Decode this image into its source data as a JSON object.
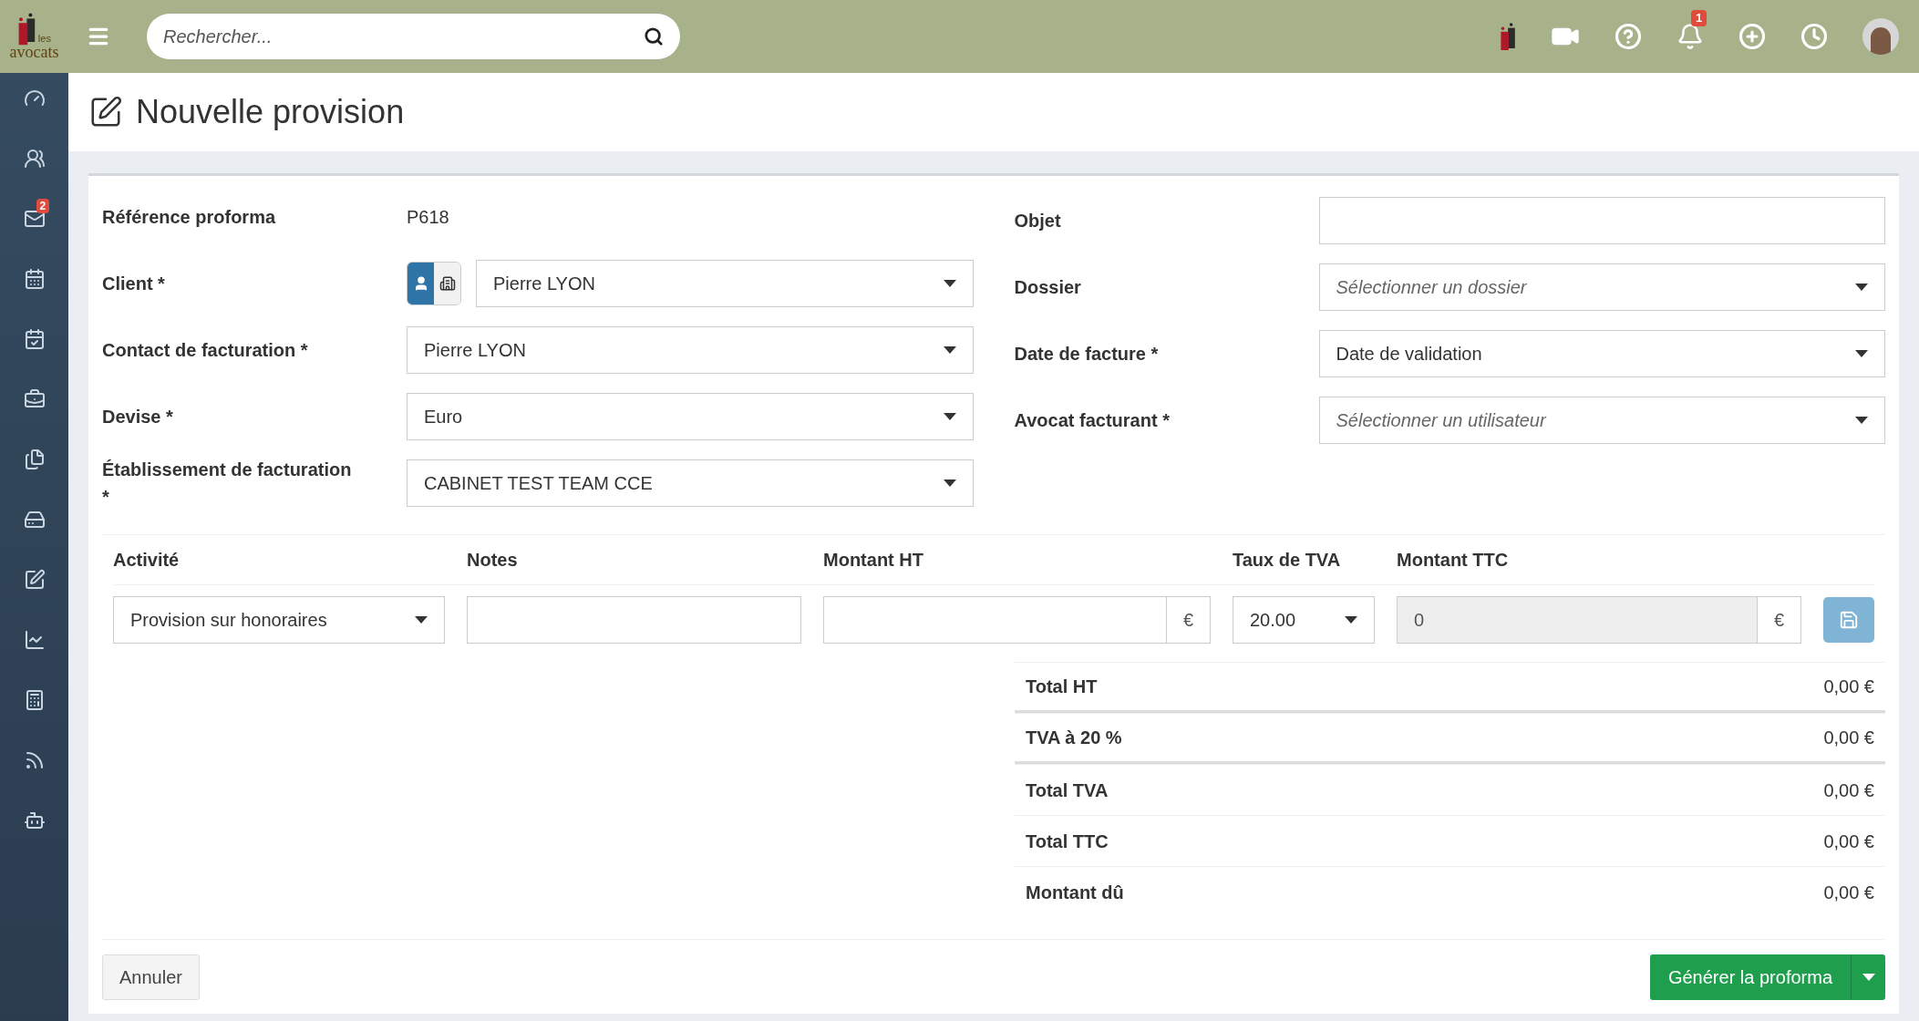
{
  "brand": {
    "small": "les",
    "name": "avocats"
  },
  "search": {
    "placeholder": "Rechercher..."
  },
  "notifications": {
    "badge": "1"
  },
  "sidebar": {
    "mail_badge": "2"
  },
  "page_title": "Nouvelle provision",
  "left_fields": [
    {
      "label": "Référence proforma",
      "kind": "static",
      "value": "P618"
    },
    {
      "label": "Client *",
      "kind": "client",
      "value": "Pierre LYON",
      "toggle": [
        {
          "selected": true
        },
        {
          "selected": false
        }
      ]
    },
    {
      "label": "Contact de facturation *",
      "kind": "select",
      "value": "Pierre LYON"
    },
    {
      "label": "Devise *",
      "kind": "select",
      "value": "Euro"
    },
    {
      "label": "Établissement de facturation *",
      "kind": "select",
      "value": "CABINET TEST TEAM CCE"
    }
  ],
  "right_fields": [
    {
      "label": "Objet",
      "kind": "input"
    },
    {
      "label": "Dossier",
      "kind": "select",
      "placeholder": "Sélectionner un dossier"
    },
    {
      "label": "Date de facture *",
      "kind": "select",
      "value": "Date de validation"
    },
    {
      "label": "Avocat facturant *",
      "kind": "select",
      "placeholder": "Sélectionner un utilisateur"
    }
  ],
  "lines": {
    "columns": [
      "Activité",
      "Notes",
      "Montant HT",
      "Taux de TVA",
      "Montant TTC"
    ],
    "row": {
      "activity": "Provision sur honoraires",
      "ht_addon": "€",
      "tva": "20.00",
      "ttc": "0",
      "ttc_addon": "€",
      "ttc_disabled": true
    }
  },
  "totals": [
    {
      "label": "Total HT",
      "value": "0,00 €",
      "strong_border": true
    },
    {
      "label": "TVA à 20 %",
      "value": "0,00 €",
      "strong_border": true
    },
    {
      "label": "Total TVA",
      "value": "0,00 €",
      "strong_border": false
    },
    {
      "label": "Total TTC",
      "value": "0,00 €",
      "strong_border": false
    },
    {
      "label": "Montant dû",
      "value": "0,00 €",
      "strong_border": false
    }
  ],
  "footer": {
    "cancel": "Annuler",
    "submit": "Générer la proforma"
  }
}
